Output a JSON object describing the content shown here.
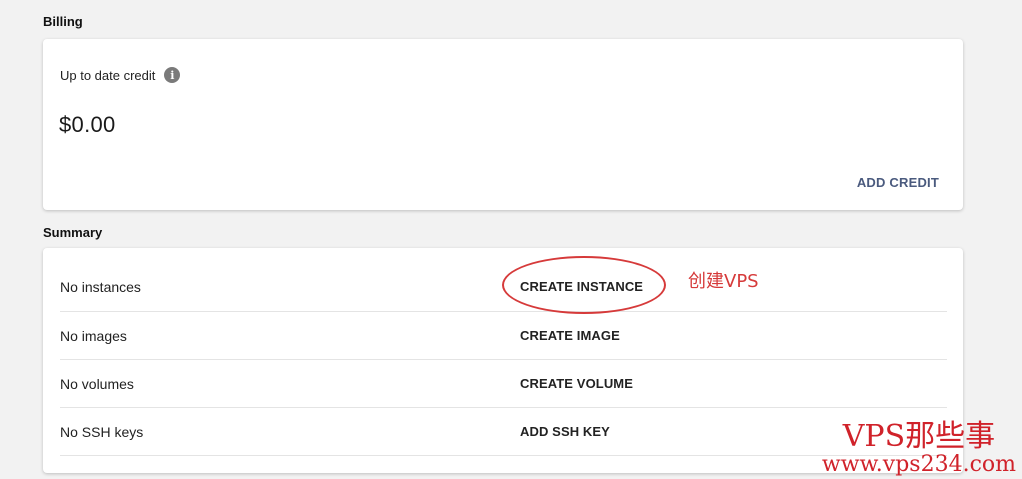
{
  "billing": {
    "section_title": "Billing",
    "credit_label": "Up to date credit",
    "info_icon": "info-icon",
    "credit_value": "$0.00",
    "add_credit_label": "ADD CREDIT"
  },
  "summary": {
    "section_title": "Summary",
    "rows": [
      {
        "label": "No instances",
        "action": "CREATE INSTANCE"
      },
      {
        "label": "No images",
        "action": "CREATE IMAGE"
      },
      {
        "label": "No volumes",
        "action": "CREATE VOLUME"
      },
      {
        "label": "No SSH keys",
        "action": "ADD SSH KEY"
      }
    ]
  },
  "annotation": {
    "text": "创建VPS",
    "color": "#d63a3a"
  },
  "watermark": {
    "title": "VPS那些事",
    "url": "www.vps234.com",
    "color": "#d0222a"
  },
  "colors": {
    "background": "#f2f2f2",
    "card": "#ffffff",
    "link_accent": "#4a5a7e"
  }
}
